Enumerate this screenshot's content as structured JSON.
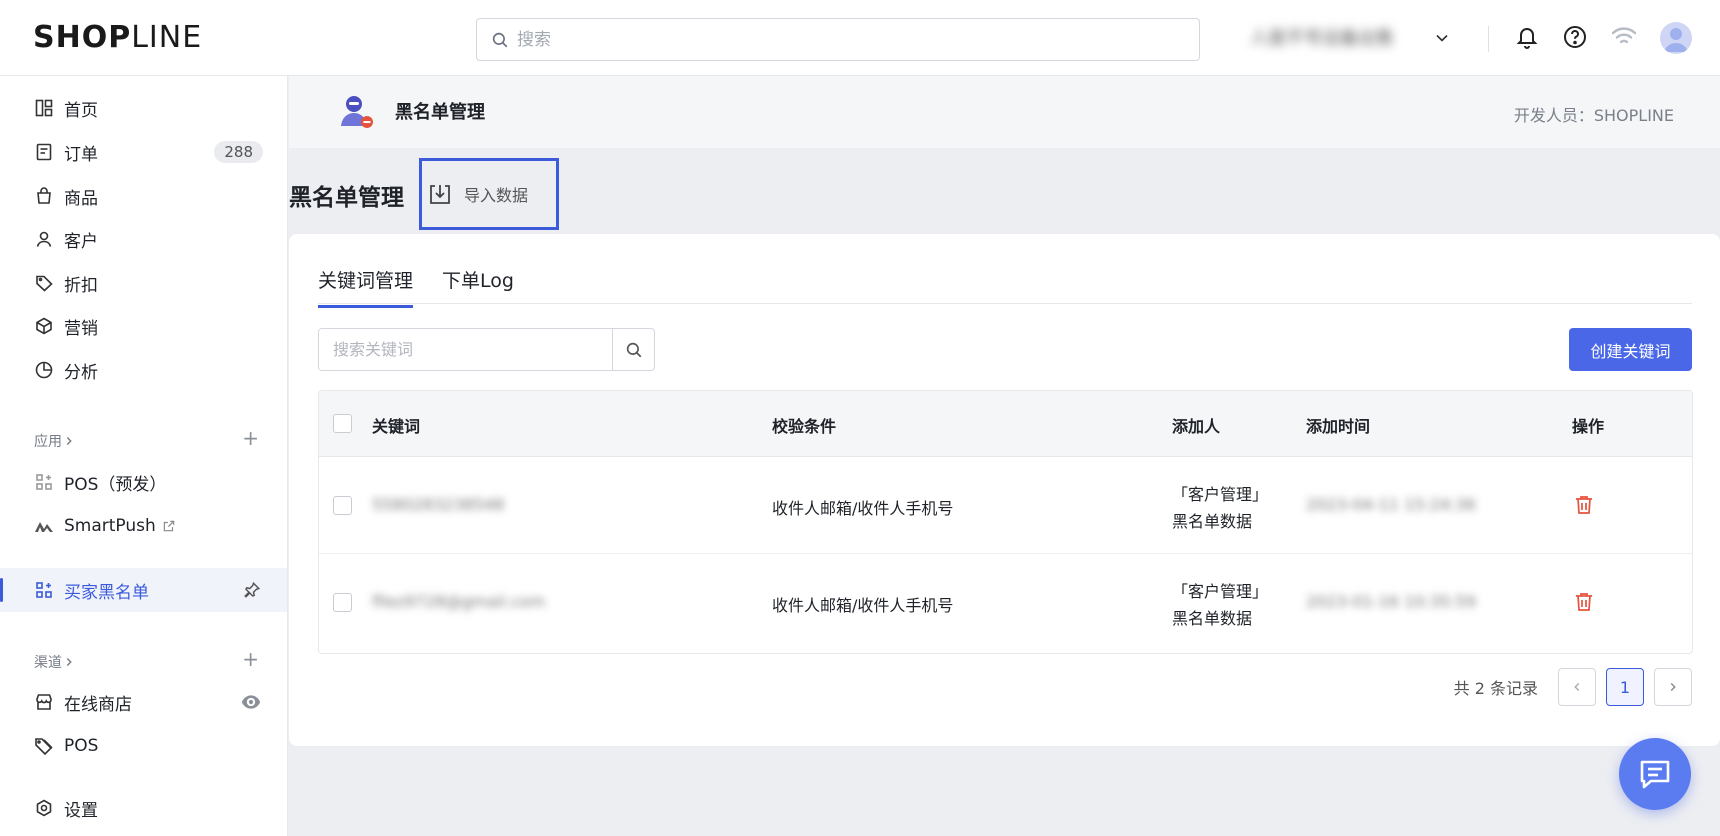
{
  "brand": {
    "logo_bold": "SHOP",
    "logo_light": "LINE"
  },
  "header": {
    "search_placeholder": "搜索",
    "store_name": "人是不号设备出售",
    "icons": [
      "bell-icon",
      "help-icon",
      "wifi-icon",
      "avatar-icon"
    ]
  },
  "sidebar": {
    "items": [
      {
        "label": "首页",
        "icon": "dashboard-icon"
      },
      {
        "label": "订单",
        "icon": "orders-icon",
        "badge": "288"
      },
      {
        "label": "商品",
        "icon": "products-icon"
      },
      {
        "label": "客户",
        "icon": "customers-icon"
      },
      {
        "label": "折扣",
        "icon": "discount-icon"
      },
      {
        "label": "营销",
        "icon": "marketing-icon"
      },
      {
        "label": "分析",
        "icon": "analytics-icon"
      }
    ],
    "apps_label": "应用",
    "apps": [
      {
        "label": "POS（预发）",
        "icon": "app-grid-icon"
      },
      {
        "label": "SmartPush",
        "icon": "smartpush-icon"
      }
    ],
    "active_app": {
      "label": "买家黑名单",
      "icon": "app-grid-icon"
    },
    "channels_label": "渠道",
    "channels": [
      {
        "label": "在线商店",
        "icon": "store-icon"
      },
      {
        "label": "POS",
        "icon": "pos-icon"
      }
    ],
    "settings_label": "设置"
  },
  "app_header": {
    "title": "黑名单管理",
    "developer": "开发人员：SHOPLINE"
  },
  "page": {
    "title": "黑名单管理",
    "import_label": "导入数据"
  },
  "tabs": [
    {
      "label": "关键词管理",
      "active": true
    },
    {
      "label": "下单Log",
      "active": false
    }
  ],
  "toolbar": {
    "search_placeholder": "搜索关键词",
    "create_label": "创建关键词"
  },
  "table": {
    "columns": [
      "关键词",
      "校验条件",
      "添加人",
      "添加时间",
      "操作"
    ],
    "rows": [
      {
        "keyword": "5580283238548",
        "condition": "收件人邮箱/收件人手机号",
        "adder_line1": "「客户管理」",
        "adder_line2": "黑名单数据",
        "time": "2023-04-11 15:24:36"
      },
      {
        "keyword": "fllez9728@gmail.com",
        "condition": "收件人邮箱/收件人手机号",
        "adder_line1": "「客户管理」",
        "adder_line2": "黑名单数据",
        "time": "2023-01-16 10:35:59"
      }
    ]
  },
  "pagination": {
    "total": "共 2 条记录",
    "current": "1"
  },
  "colors": {
    "accent": "#3b5bdb",
    "primary_button": "#4a67e8",
    "danger": "#e5533d"
  }
}
